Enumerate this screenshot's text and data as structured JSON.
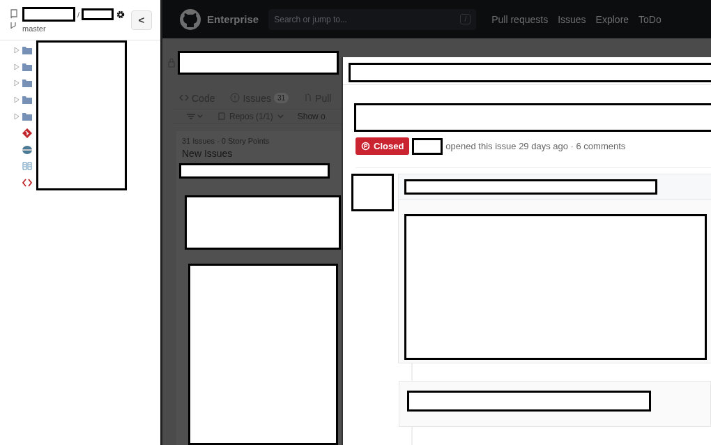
{
  "sidebar": {
    "separator": "/",
    "branch": "master",
    "collapse_button": "<",
    "tree": [
      {
        "kind": "folder",
        "expanded": false
      },
      {
        "kind": "folder",
        "expanded": false
      },
      {
        "kind": "folder",
        "expanded": false
      },
      {
        "kind": "folder",
        "expanded": false
      },
      {
        "kind": "folder",
        "expanded": false
      },
      {
        "kind": "git"
      },
      {
        "kind": "database"
      },
      {
        "kind": "book"
      },
      {
        "kind": "code"
      }
    ]
  },
  "header": {
    "brand": "Enterprise",
    "search": {
      "placeholder": "Search or jump to...",
      "key": "/"
    },
    "links": [
      "Pull requests",
      "Issues",
      "Explore",
      "ToDo"
    ]
  },
  "repo": {
    "tabs": [
      {
        "label": "Code"
      },
      {
        "label": "Issues",
        "count": "31"
      },
      {
        "label": "Pull"
      }
    ],
    "filters": {
      "repos": "Repos (1/1)",
      "show": "Show o"
    },
    "column": {
      "summary": "31 Issues - 0 Story Points",
      "title": "New Issues"
    }
  },
  "issue": {
    "state_label": "Closed",
    "meta": "opened this issue 29 days ago · 6 comments"
  }
}
